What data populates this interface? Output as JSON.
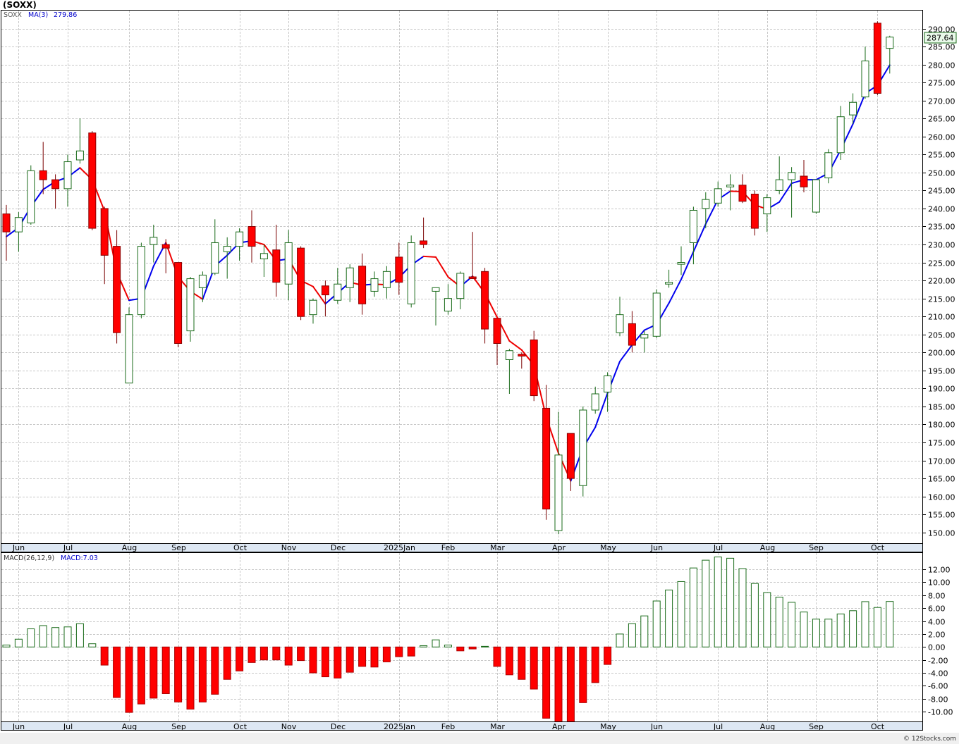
{
  "header": {
    "symbol_label": "(SOXX)"
  },
  "legend": {
    "symbol": "SOXX",
    "ma_label": "MA(3)",
    "ma_value": "279.86",
    "macd_params": "MACD(26,12,9)",
    "macd_value": "MACD:7.03"
  },
  "last_price_label": "287.64",
  "credit": "© 12Stocks.com",
  "colors": {
    "up": "#1a6b1a",
    "down": "#ff0000",
    "ma_up": "#0000ee",
    "ma_down": "#ee0000",
    "grid": "#c8c8c8",
    "axis_band": "#dde7f3",
    "macd_pos": "#1a6b1a",
    "macd_neg": "#ff0000",
    "price_tag": "#e9f9e9"
  },
  "chart_data": [
    {
      "type": "candlestick",
      "title": "SOXX",
      "interval": "weekly",
      "ylim": [
        147,
        295
      ],
      "y_ticks": [
        150,
        155,
        160,
        165,
        170,
        175,
        180,
        185,
        190,
        195,
        200,
        205,
        210,
        215,
        220,
        225,
        230,
        235,
        240,
        245,
        250,
        255,
        260,
        265,
        270,
        275,
        280,
        285,
        290
      ],
      "x_month_labels": [
        {
          "label": "Jun",
          "bar": 1
        },
        {
          "label": "Jul",
          "bar": 5
        },
        {
          "label": "Aug",
          "bar": 10
        },
        {
          "label": "Sep",
          "bar": 14
        },
        {
          "label": "Oct",
          "bar": 19
        },
        {
          "label": "Nov",
          "bar": 23
        },
        {
          "label": "Dec",
          "bar": 27
        },
        {
          "label": "2025Jan",
          "bar": 32
        },
        {
          "label": "Feb",
          "bar": 36
        },
        {
          "label": "Mar",
          "bar": 40
        },
        {
          "label": "Apr",
          "bar": 45
        },
        {
          "label": "May",
          "bar": 49
        },
        {
          "label": "Jun",
          "bar": 53
        },
        {
          "label": "Jul",
          "bar": 58
        },
        {
          "label": "Aug",
          "bar": 62
        },
        {
          "label": "Sep",
          "bar": 66
        },
        {
          "label": "Oct",
          "bar": 71
        }
      ],
      "ohlc": [
        [
          238.5,
          241.0,
          225.5,
          233.5
        ],
        [
          233.5,
          239.0,
          228.0,
          237.5
        ],
        [
          236.0,
          252.0,
          235.5,
          250.5
        ],
        [
          250.5,
          258.5,
          244.0,
          248.0
        ],
        [
          248.0,
          249.5,
          240.0,
          245.5
        ],
        [
          245.5,
          255.0,
          240.5,
          253.0
        ],
        [
          253.5,
          265.0,
          252.5,
          256.0
        ],
        [
          261.0,
          261.5,
          234.0,
          234.5
        ],
        [
          240.0,
          240.5,
          219.0,
          227.0
        ],
        [
          229.5,
          234.0,
          202.5,
          205.5
        ],
        [
          191.5,
          212.5,
          191.5,
          210.5
        ],
        [
          210.5,
          230.5,
          209.5,
          229.5
        ],
        [
          230.0,
          235.5,
          225.0,
          232.0
        ],
        [
          230.0,
          231.5,
          222.0,
          229.0
        ],
        [
          225.0,
          225.0,
          201.5,
          202.5
        ],
        [
          206.0,
          221.0,
          203.0,
          220.5
        ],
        [
          218.0,
          222.5,
          214.0,
          221.5
        ],
        [
          222.0,
          237.0,
          221.5,
          230.5
        ],
        [
          228.0,
          232.0,
          220.5,
          229.5
        ],
        [
          229.5,
          234.5,
          225.5,
          233.5
        ],
        [
          235.0,
          239.5,
          225.0,
          229.5
        ],
        [
          226.0,
          230.0,
          221.0,
          227.5
        ],
        [
          228.5,
          235.5,
          215.5,
          219.5
        ],
        [
          219.0,
          234.0,
          214.5,
          230.5
        ],
        [
          229.0,
          229.5,
          209.0,
          210.0
        ],
        [
          210.5,
          215.0,
          208.0,
          214.5
        ],
        [
          218.5,
          220.0,
          210.0,
          216.0
        ],
        [
          214.5,
          223.5,
          213.5,
          219.0
        ],
        [
          218.0,
          224.5,
          214.0,
          223.5
        ],
        [
          224.0,
          227.5,
          210.5,
          213.5
        ],
        [
          217.0,
          222.5,
          215.5,
          220.5
        ],
        [
          218.0,
          224.0,
          215.0,
          222.5
        ],
        [
          226.5,
          230.5,
          216.0,
          219.5
        ],
        [
          213.5,
          232.5,
          212.5,
          230.5
        ],
        [
          231.0,
          237.5,
          229.0,
          230.0
        ],
        [
          217.0,
          218.0,
          207.5,
          218.0
        ],
        [
          211.5,
          219.0,
          210.5,
          215.0
        ],
        [
          215.0,
          222.5,
          212.0,
          222.0
        ],
        [
          221.0,
          233.5,
          220.5,
          220.5
        ],
        [
          222.5,
          223.5,
          202.5,
          206.5
        ],
        [
          209.5,
          209.5,
          196.5,
          202.5
        ],
        [
          198.0,
          201.0,
          188.5,
          200.5
        ],
        [
          199.5,
          200.0,
          195.5,
          199.0
        ],
        [
          203.5,
          206.0,
          186.5,
          188.0
        ],
        [
          184.5,
          191.0,
          153.5,
          156.5
        ],
        [
          150.5,
          183.5,
          149.5,
          171.5
        ],
        [
          177.5,
          177.5,
          161.5,
          165.0
        ],
        [
          163.0,
          185.0,
          160.0,
          184.0
        ],
        [
          184.0,
          190.5,
          183.0,
          188.5
        ],
        [
          189.0,
          194.5,
          183.5,
          193.5
        ],
        [
          205.5,
          215.5,
          204.5,
          210.5
        ],
        [
          208.0,
          211.5,
          200.0,
          202.0
        ],
        [
          204.0,
          206.0,
          200.0,
          205.0
        ],
        [
          204.5,
          217.5,
          204.0,
          216.5
        ],
        [
          219.0,
          223.0,
          218.0,
          219.5
        ],
        [
          224.5,
          229.5,
          221.5,
          225.0
        ],
        [
          230.5,
          240.5,
          224.5,
          239.5
        ],
        [
          240.0,
          244.5,
          234.5,
          242.5
        ],
        [
          241.5,
          247.5,
          240.5,
          245.5
        ],
        [
          246.0,
          249.5,
          239.5,
          246.5
        ],
        [
          246.5,
          249.5,
          241.5,
          242.0
        ],
        [
          244.0,
          245.0,
          232.5,
          234.5
        ],
        [
          238.5,
          244.0,
          233.5,
          243.0
        ],
        [
          245.0,
          254.5,
          244.0,
          248.0
        ],
        [
          248.0,
          251.5,
          237.5,
          250.0
        ],
        [
          249.0,
          253.5,
          244.5,
          246.0
        ],
        [
          239.0,
          248.0,
          238.5,
          248.0
        ],
        [
          248.5,
          256.5,
          247.0,
          255.5
        ],
        [
          255.5,
          268.5,
          253.5,
          265.5
        ],
        [
          266.0,
          272.0,
          263.5,
          269.5
        ],
        [
          271.0,
          285.0,
          270.5,
          281.0
        ],
        [
          291.5,
          292.0,
          271.5,
          272.0
        ],
        [
          284.5,
          288.0,
          277.5,
          287.64
        ]
      ],
      "ma3": [
        232.2,
        234.7,
        240.5,
        245.3,
        247.5,
        248.7,
        251.3,
        248.0,
        239.3,
        222.3,
        214.5,
        215.0,
        224.0,
        230.5,
        221.0,
        217.0,
        214.8,
        224.0,
        227.0,
        230.5,
        231.0,
        230.0,
        225.5,
        226.0,
        220.0,
        218.3,
        213.5,
        216.5,
        219.5,
        218.7,
        219.0,
        218.8,
        220.8,
        224.3,
        226.7,
        226.5,
        221.0,
        218.3,
        221.2,
        216.5,
        209.8,
        203.2,
        200.7,
        196.5,
        182.0,
        172.0,
        164.3,
        173.5,
        179.2,
        188.7,
        197.5,
        202.1,
        206.2,
        207.8,
        213.7,
        220.3,
        228.0,
        235.7,
        242.5,
        244.8,
        244.7,
        241.0,
        239.8,
        241.8,
        247.0,
        248.0,
        248.0,
        249.8,
        256.3,
        263.5,
        272.0,
        274.2,
        279.86
      ],
      "ma3_start_bar": 0
    },
    {
      "type": "bar",
      "title": "MACD(26,12,9)",
      "ylim": [
        -11.5,
        14.5
      ],
      "y_ticks": [
        -10,
        -8,
        -6,
        -4,
        -2,
        0,
        2,
        4,
        6,
        8,
        10,
        12
      ],
      "values": [
        0.3,
        1.2,
        2.8,
        3.3,
        3.0,
        3.1,
        3.6,
        0.5,
        -2.8,
        -7.8,
        -10.1,
        -8.8,
        -7.9,
        -7.2,
        -8.5,
        -9.6,
        -8.5,
        -7.3,
        -5.0,
        -3.7,
        -2.4,
        -2.0,
        -2.0,
        -2.8,
        -2.1,
        -4.0,
        -4.6,
        -4.8,
        -3.9,
        -3.0,
        -3.1,
        -2.3,
        -1.5,
        -1.4,
        0.2,
        1.1,
        0.3,
        -0.6,
        -0.3,
        0.1,
        -3.0,
        -4.3,
        -5.0,
        -6.5,
        -11.0,
        -12.5,
        -12.8,
        -8.6,
        -5.5,
        -2.7,
        2.0,
        3.6,
        4.8,
        7.1,
        8.8,
        10.1,
        12.2,
        13.4,
        13.9,
        13.7,
        12.1,
        9.8,
        8.4,
        7.7,
        6.9,
        5.4,
        4.3,
        4.3,
        5.1,
        5.6,
        7.0,
        6.1,
        7.03
      ]
    }
  ]
}
